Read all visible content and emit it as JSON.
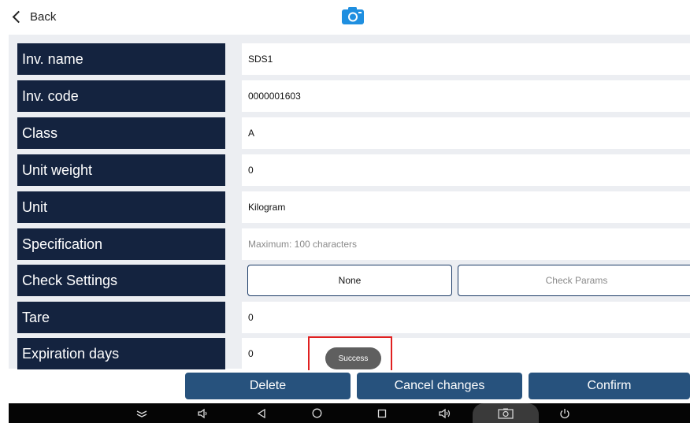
{
  "header": {
    "back_label": "Back",
    "camera_icon": "camera-icon"
  },
  "form": {
    "rows": [
      {
        "label": "Inv. name",
        "value": "SDS1"
      },
      {
        "label": "Inv. code",
        "value": "0000001603"
      },
      {
        "label": "Class",
        "value": "A"
      },
      {
        "label": "Unit weight",
        "value": "0"
      },
      {
        "label": "Unit",
        "value": "Kilogram"
      },
      {
        "label": "Specification",
        "placeholder": "Maximum: 100 characters"
      },
      {
        "label": "Check Settings",
        "check_setting": "None",
        "check_params": "Check Params"
      },
      {
        "label": "Tare",
        "value": "0"
      },
      {
        "label": "Expiration days",
        "value": "0"
      }
    ]
  },
  "toast": {
    "text": "Success"
  },
  "actions": {
    "delete_label": "Delete",
    "cancel_label": "Cancel changes",
    "confirm_label": "Confirm"
  },
  "navbar": {
    "icons": [
      "expand-icon",
      "volume-down-icon",
      "back-triangle-icon",
      "home-circle-icon",
      "recents-square-icon",
      "volume-up-icon",
      "screenshot-icon",
      "power-icon"
    ]
  },
  "colors": {
    "label_bg": "#14233f",
    "button_bg": "#27527d",
    "form_bg": "#eceef2",
    "camera": "#1f8fe0",
    "toast_highlight": "#e02020"
  }
}
